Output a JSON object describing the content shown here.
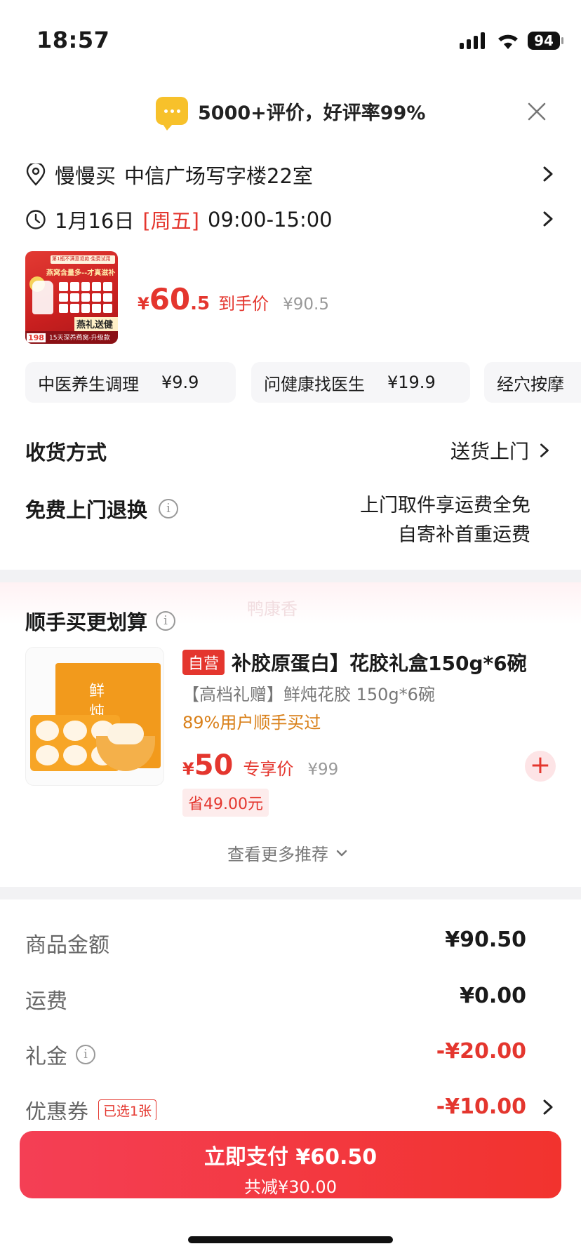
{
  "status_bar": {
    "time": "18:57",
    "battery": "94"
  },
  "review_banner": {
    "text": "5000+评价，好评率99%",
    "icon": "chat-bubble-icon"
  },
  "address": {
    "recipient": "慢慢买",
    "location": "中信广场写字楼22室"
  },
  "delivery_time": {
    "date": "1月16日",
    "weekday": "[周五]",
    "window": "09:00-15:00"
  },
  "summary": {
    "price_yen": "¥",
    "price_int": "60",
    "price_dec": ".5",
    "price_label": "到手价",
    "original_price": "¥90.5",
    "thumb_texts": {
      "badge": "第1瓶不满意退款·免费试用",
      "headline": "燕窝含量多--才真滋补",
      "ribbon": "燕礼送健康",
      "footer": "15天深养燕窝-升级款",
      "price": "198"
    }
  },
  "service_cards": [
    {
      "name": "中医养生调理",
      "price": "¥9.9"
    },
    {
      "name": "问健康找医生",
      "price": "¥19.9"
    },
    {
      "name": "经穴按摩",
      "price": ""
    }
  ],
  "shipping": {
    "label": "收货方式",
    "value": "送货上门"
  },
  "return_service": {
    "label": "免费上门退换",
    "line1": "上门取件享运费全免",
    "line2": "自寄补首重运费"
  },
  "bundle": {
    "title": "顺手买更划算",
    "watermark": "鸭康香",
    "product": {
      "tag": "自营",
      "name": "补胶原蛋白】花胶礼盒150g*6碗",
      "subtitle": "【高档礼赠】鲜炖花胶 150g*6碗",
      "social": "89%用户顺手买过",
      "box_text": "鲜炖花胶",
      "price_yen": "¥",
      "price": "50",
      "price_label": "专享价",
      "original_price": "¥99",
      "save": "省49.00元"
    },
    "more": "查看更多推荐"
  },
  "order_summary": {
    "goods_label": "商品金额",
    "goods_value": "¥90.50",
    "freight_label": "运费",
    "freight_value": "¥0.00",
    "gift_label": "礼金",
    "gift_value": "-¥20.00",
    "coupon_label": "优惠券",
    "coupon_tag": "已选1张",
    "coupon_value": "-¥10.00"
  },
  "pay_button": {
    "main": "立即支付 ¥60.50",
    "sub": "共减¥30.00"
  },
  "colors": {
    "accent_red": "#e4362e",
    "pay_gradient_start": "#f43f55",
    "pay_gradient_end": "#f2332e",
    "review_icon": "#f7c12b"
  }
}
